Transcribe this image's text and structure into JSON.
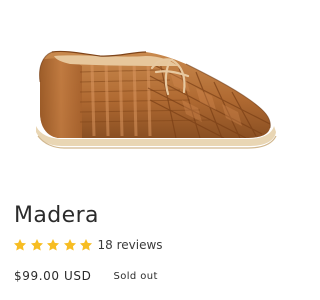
{
  "product": {
    "image_alt": "Tan woven leather huarache shoe",
    "title": "Madera",
    "rating": {
      "stars": 5,
      "max": 5,
      "review_count": "18 reviews"
    },
    "price": "$99.00 USD",
    "availability": "Sold out"
  },
  "colors": {
    "star": "#f7bd22",
    "text": "#2b2b2b",
    "leather": "#b8733c",
    "sole": "#e9d6b4"
  },
  "icons": {
    "rating": "star-icon"
  }
}
